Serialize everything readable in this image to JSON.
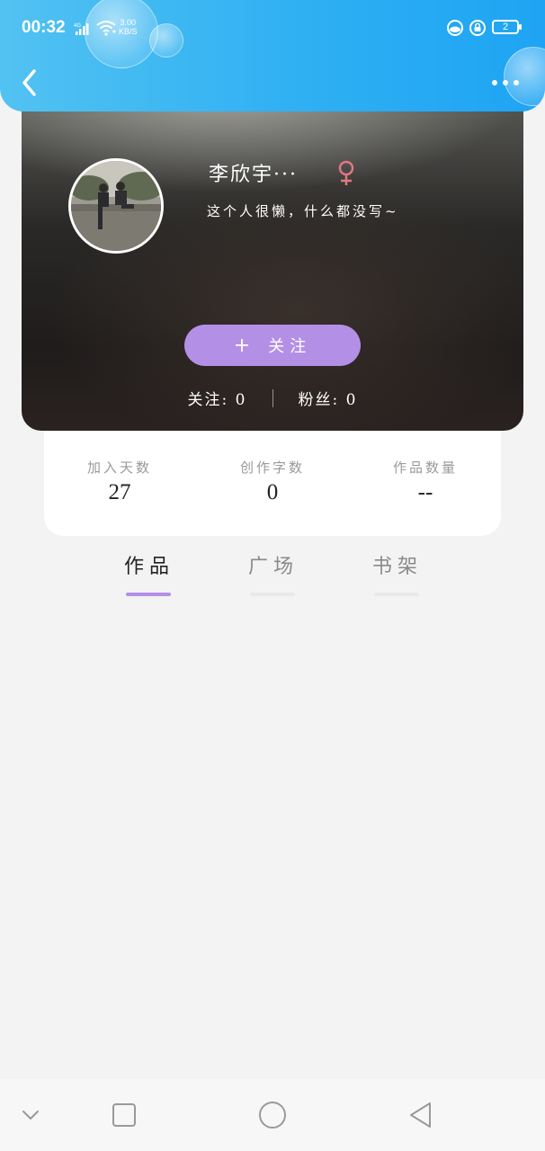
{
  "status_bar": {
    "time": "00:32",
    "network_type": "4G",
    "net_speed_value": "3.00",
    "net_speed_unit": "KB/S",
    "battery_level": "2"
  },
  "header": {
    "back_icon": "chevron-left-icon",
    "more_icon": "more-horizontal-icon"
  },
  "profile": {
    "username": "李欣宇···",
    "gender_symbol": "♀",
    "gender_color": "#e0787f",
    "bio": "这个人很懒，什么都没写~",
    "follow_plus": "+",
    "follow_label": "关注",
    "following_label": "关注:",
    "following_count": "0",
    "followers_label": "粉丝:",
    "followers_count": "0"
  },
  "stats": {
    "items": [
      {
        "label": "加入天数",
        "value": "27"
      },
      {
        "label": "创作字数",
        "value": "0"
      },
      {
        "label": "作品数量",
        "value": "--"
      }
    ]
  },
  "tabs": {
    "items": [
      {
        "label": "作品",
        "active": true
      },
      {
        "label": "广场",
        "active": false
      },
      {
        "label": "书架",
        "active": false
      }
    ],
    "accent_color": "#b48fe6"
  },
  "colors": {
    "header_blue": "#2fb0f3",
    "accent_purple": "#b48fe6",
    "background": "#f3f3f3"
  },
  "navbar": {
    "icons": [
      "chevron-down-icon",
      "square-icon",
      "circle-icon",
      "triangle-back-icon"
    ]
  }
}
